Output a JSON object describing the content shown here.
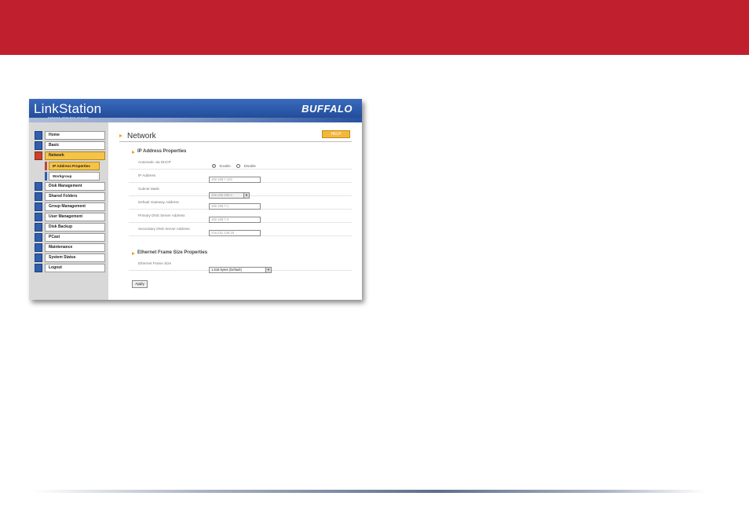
{
  "brand": {
    "name": "LinkStation",
    "tagline": "network attached storage",
    "vendor": "BUFFALO"
  },
  "colors": {
    "banner": "#c0202e",
    "header_blue": "#2a56a6",
    "active_nav": "#f4c44a",
    "help_button": "#f4b73e"
  },
  "sidebar": {
    "items": [
      {
        "label": "Home",
        "icon": "home-icon"
      },
      {
        "label": "Basic",
        "icon": "basic-settings-icon"
      },
      {
        "label": "Network",
        "icon": "network-icon",
        "active": true
      },
      {
        "label": "IP Address Properties",
        "sub": true,
        "active": true
      },
      {
        "label": "Workgroup",
        "sub": true
      },
      {
        "label": "Disk Management",
        "icon": "disk-icon"
      },
      {
        "label": "Shared Folders",
        "icon": "folder-icon"
      },
      {
        "label": "Group Management",
        "icon": "group-icon"
      },
      {
        "label": "User Management",
        "icon": "user-icon"
      },
      {
        "label": "Disk Backup",
        "icon": "backup-icon"
      },
      {
        "label": "PCast",
        "icon": "pcast-icon"
      },
      {
        "label": "Maintenance",
        "icon": "maintenance-icon"
      },
      {
        "label": "System Status",
        "icon": "status-icon"
      },
      {
        "label": "Logout",
        "icon": "logout-icon"
      }
    ]
  },
  "main": {
    "title": "Network",
    "help_label": "HELP",
    "ip_section": {
      "title": "IP Address Properties",
      "dhcp_label": "Automatic via DHCP",
      "enable_label": "Enable",
      "disable_label": "Disable",
      "ip_label": "IP Address",
      "ip_value": "192.168.7.103",
      "subnet_label": "Subnet Mask",
      "subnet_value": "255.255.255.0",
      "gateway_label": "Default Gateway Address",
      "gateway_value": "192.168.7.1",
      "dns1_label": "Primary DNS Server Address",
      "dns1_value": "192.168.7.3",
      "dns2_label": "Secondary DNS Server Address",
      "dns2_value": "216.231.128.16"
    },
    "frame_section": {
      "title": "Ethernet Frame Size Properties",
      "frame_label": "Ethernet Frame Size",
      "frame_value": "1,518 bytes (Default)"
    },
    "apply_label": "Apply"
  }
}
